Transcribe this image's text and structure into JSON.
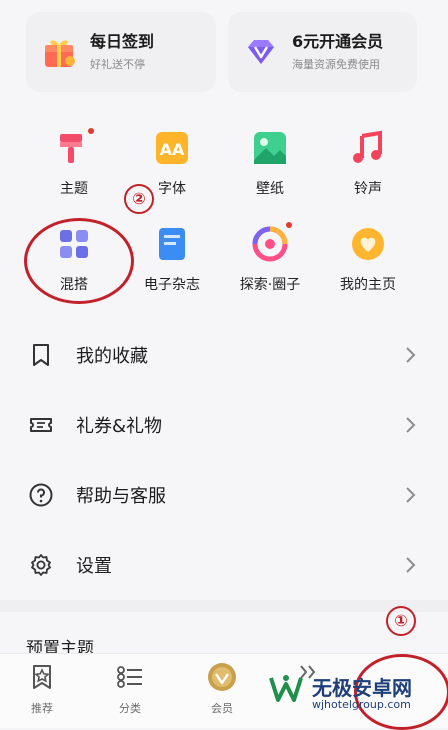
{
  "promo": [
    {
      "title": "每日签到",
      "subtitle": "好礼送不停",
      "icon": "gift-icon"
    },
    {
      "title": "6元开通会员",
      "subtitle": "海量资源免费使用",
      "icon": "diamond-icon"
    }
  ],
  "grid": [
    {
      "label": "主题",
      "icon": "brush-icon"
    },
    {
      "label": "字体",
      "icon": "font-icon"
    },
    {
      "label": "壁纸",
      "icon": "wallpaper-icon"
    },
    {
      "label": "铃声",
      "icon": "music-icon"
    },
    {
      "label": "混搭",
      "icon": "grid-icon"
    },
    {
      "label": "电子杂志",
      "icon": "magazine-icon"
    },
    {
      "label": "探索·圈子",
      "icon": "explore-icon"
    },
    {
      "label": "我的主页",
      "icon": "heart-icon"
    }
  ],
  "menu": [
    {
      "label": "我的收藏",
      "icon": "bookmark-icon"
    },
    {
      "label": "礼券&礼物",
      "icon": "ticket-icon"
    },
    {
      "label": "帮助与客服",
      "icon": "help-icon"
    },
    {
      "label": "设置",
      "icon": "settings-icon"
    }
  ],
  "preset_title": "预置主题",
  "bottom_nav": [
    {
      "label": "推荐",
      "icon": "star-bookmark-icon"
    },
    {
      "label": "分类",
      "icon": "list-icon"
    },
    {
      "label": "会员",
      "icon": "vip-icon"
    }
  ],
  "annotations": {
    "step1": "①",
    "step2": "②"
  },
  "watermark": {
    "text": "无极安卓网",
    "url": "wjhotelgroup.com"
  },
  "colors": {
    "annotation": "#c3212a",
    "accent_dot": "#e5382f"
  }
}
